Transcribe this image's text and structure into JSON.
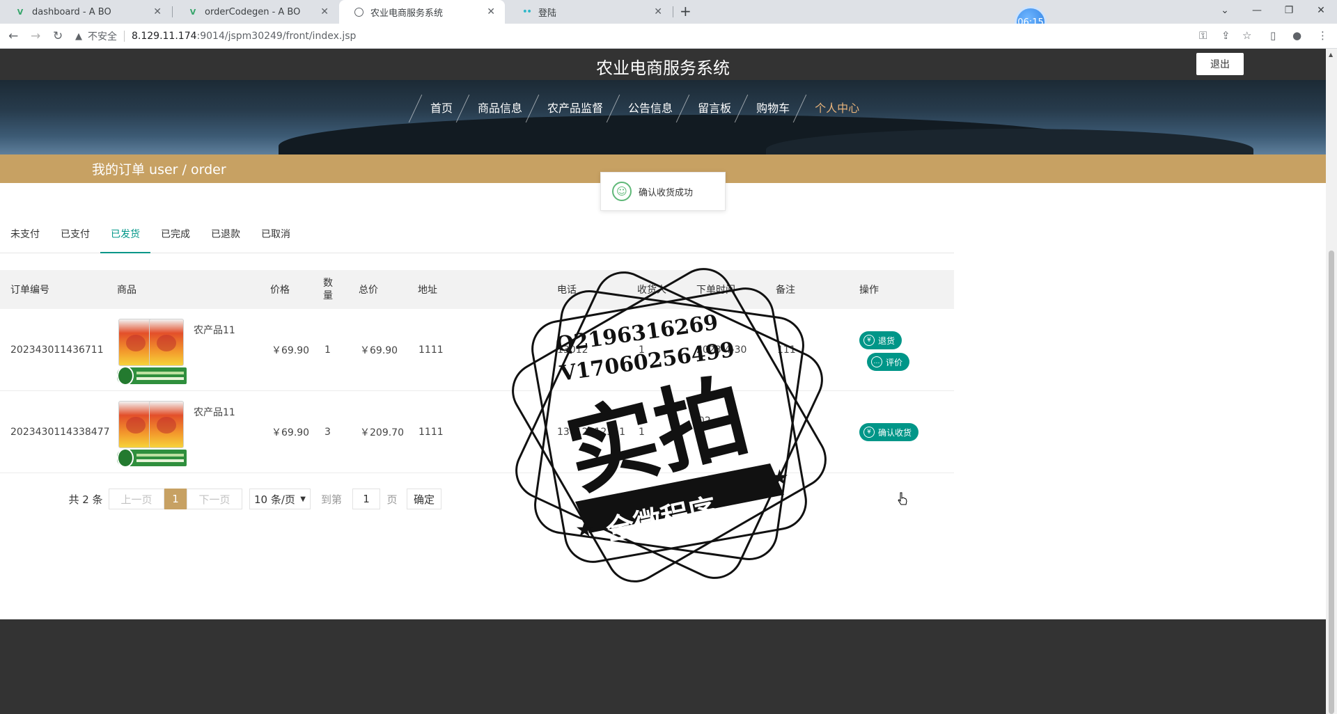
{
  "browser": {
    "tabs": [
      {
        "title": "dashboard - A BO"
      },
      {
        "title": "orderCodegen - A BO"
      },
      {
        "title": "农业电商服务系统"
      },
      {
        "title": "登陆"
      }
    ],
    "timer": "06:15",
    "address": {
      "security": "不安全",
      "host": "8.129.11.174",
      "path": ":9014/jspm30249/front/index.jsp"
    }
  },
  "site": {
    "title": "农业电商服务系统",
    "logout_label": "退出",
    "menu": [
      {
        "label": "首页"
      },
      {
        "label": "商品信息"
      },
      {
        "label": "农产品监督"
      },
      {
        "label": "公告信息"
      },
      {
        "label": "留言板"
      },
      {
        "label": "购物车"
      },
      {
        "label": "个人中心"
      }
    ],
    "active_menu": "个人中心",
    "accent_color": "#c7a163",
    "primary_color": "#009688"
  },
  "banner": {
    "text": "我的订单  user / order"
  },
  "toast": {
    "message": "确认收货成功"
  },
  "order_tabs": [
    {
      "label": "未支付"
    },
    {
      "label": "已支付"
    },
    {
      "label": "已发货"
    },
    {
      "label": "已完成"
    },
    {
      "label": "已退款"
    },
    {
      "label": "已取消"
    }
  ],
  "active_order_tab": "已发货",
  "table": {
    "headers": {
      "order_no": "订单编号",
      "product": "商品",
      "price": "价格",
      "qty_line1": "数",
      "qty_line2": "量",
      "total": "总价",
      "address": "地址",
      "phone": "电话",
      "receiver": "收货人",
      "time": "下单时间",
      "remark": "备注",
      "action": "操作"
    },
    "rows": [
      {
        "order_no": "202343011436711",
        "product": "农产品11",
        "price": "￥69.90",
        "qty": "1",
        "total": "￥69.90",
        "address": "1111",
        "phone": "13012",
        "receiver": "1",
        "time": "2023-4-30",
        "remark": "111",
        "actions": [
          "退货",
          "评价"
        ]
      },
      {
        "order_no": "2023430114338477",
        "product": "农产品11",
        "price": "￥69.90",
        "qty": "3",
        "total": "￥209.70",
        "address": "1111",
        "phone": "13012312311",
        "receiver": "1",
        "time": "202",
        "remark": "",
        "actions": [
          "确认收货"
        ]
      }
    ]
  },
  "pager": {
    "total": "共 2 条",
    "prev": "上一页",
    "current": "1",
    "next": "下一页",
    "page_size": "10 条/页",
    "goto_label": "到第",
    "goto_value": "1",
    "page_unit": "页",
    "confirm": "确定"
  },
  "watermark": {
    "line1": "Q2196316269",
    "line2": "V17060256499",
    "main": "实拍",
    "ribbon": "全微程序"
  }
}
